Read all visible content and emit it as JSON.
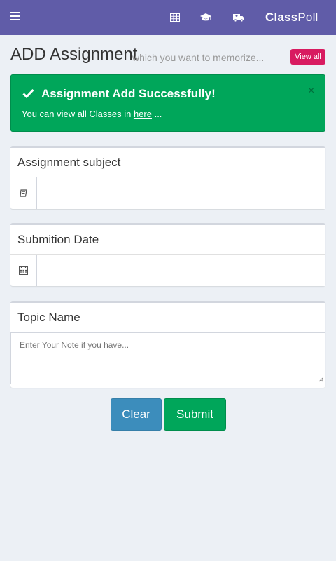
{
  "navbar": {
    "brand_bold": "Class",
    "brand_light": "Poll",
    "icons": [
      "menu-icon",
      "table-icon",
      "graduation-cap-icon",
      "ambulance-icon"
    ]
  },
  "page": {
    "title": "ADD Assignment",
    "subtitle": "which you want to memorize...",
    "view_all_label": "View all"
  },
  "alert": {
    "title": "Assignment Add Successfully!",
    "message_prefix": "You can view all Classes in ",
    "link_text": "here",
    "message_suffix": " ...",
    "close": "×"
  },
  "form": {
    "subject": {
      "label": "Assignment subject",
      "value": ""
    },
    "date": {
      "label": "Submition Date",
      "value": ""
    },
    "topic": {
      "label": "Topic Name",
      "placeholder": "Enter Your Note if you have..."
    }
  },
  "buttons": {
    "clear": "Clear",
    "submit": "Submit"
  },
  "colors": {
    "navbar": "#605ca8",
    "alert": "#00a65a",
    "clear": "#3c8dbc",
    "submit": "#00a65a",
    "view_all": "#d81b60"
  }
}
